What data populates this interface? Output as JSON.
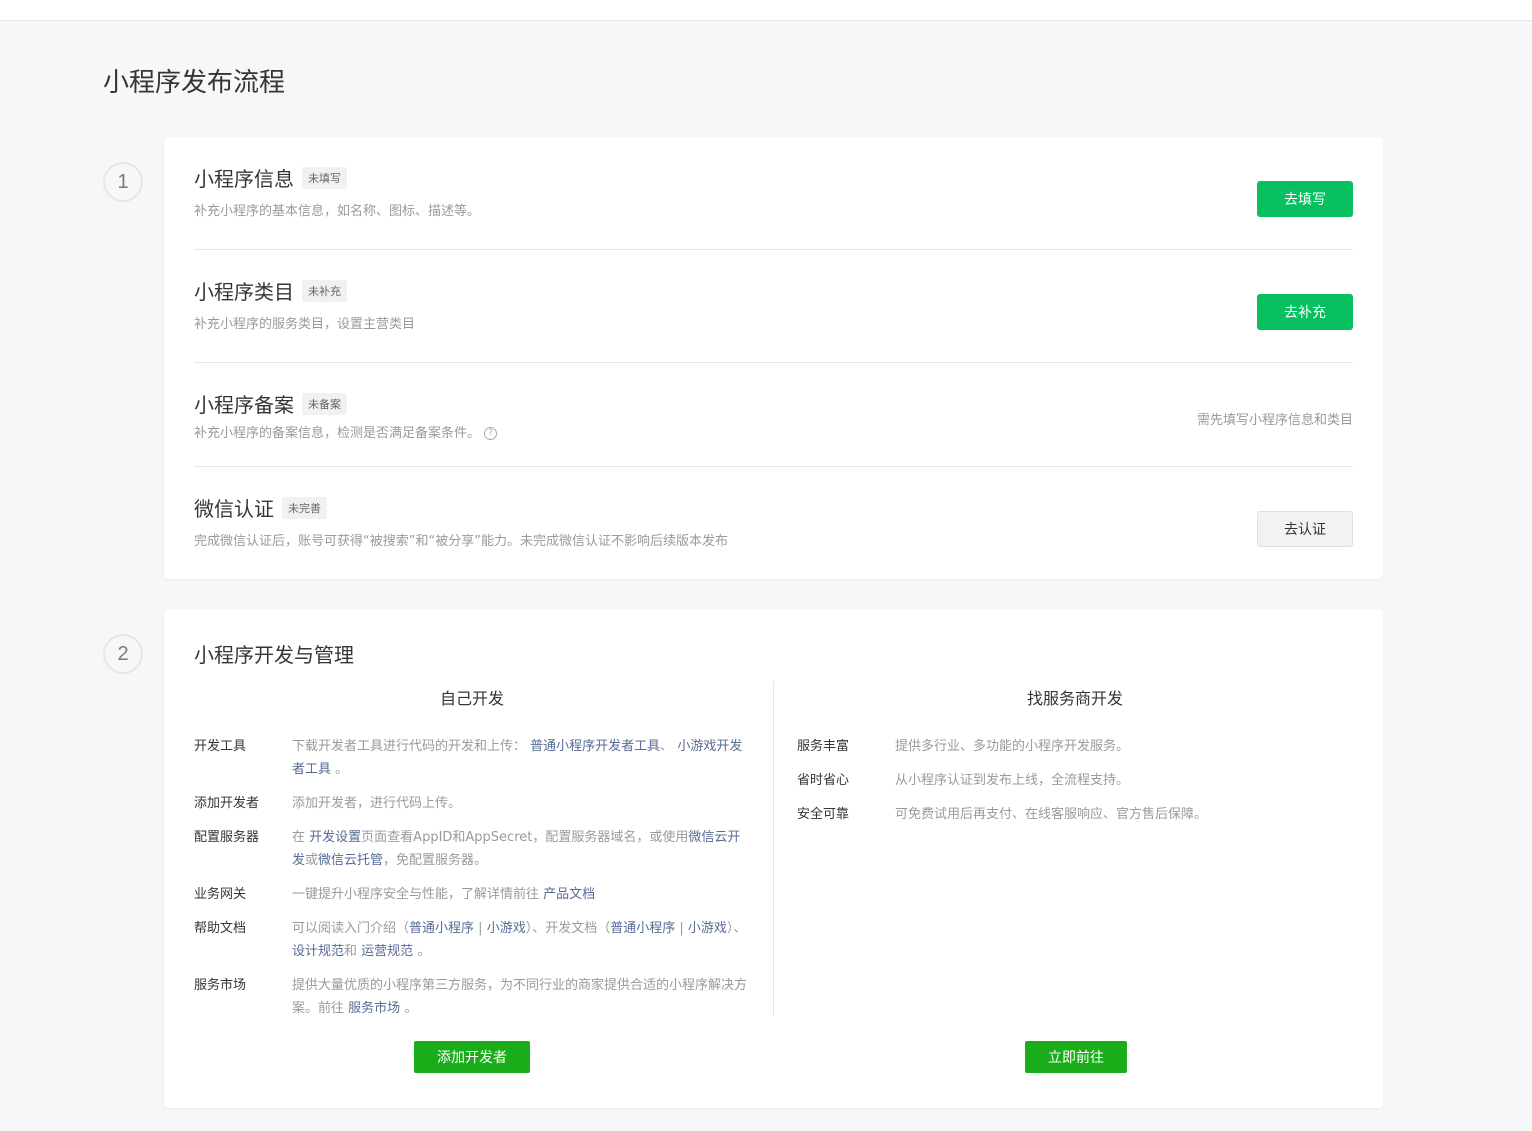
{
  "page": {
    "title": "小程序发布流程"
  },
  "steps": {
    "one": "1",
    "two": "2"
  },
  "publish_rows": [
    {
      "title": "小程序信息",
      "tag": "未填写",
      "desc": "补充小程序的基本信息，如名称、图标、描述等。",
      "action": "去填写"
    },
    {
      "title": "小程序类目",
      "tag": "未补充",
      "desc": "补充小程序的服务类目，设置主营类目",
      "action": "去补充"
    },
    {
      "title": "小程序备案",
      "tag": "未备案",
      "desc": "补充小程序的备案信息，检测是否满足备案条件。",
      "hint": "需先填写小程序信息和类目",
      "help_glyph": "?"
    },
    {
      "title": "微信认证",
      "tag": "未完善",
      "desc": "完成微信认证后，账号可获得“被搜索”和“被分享”能力。未完成微信认证不影响后续版本发布",
      "action": "去认证"
    }
  ],
  "dev": {
    "title": "小程序开发与管理",
    "self": {
      "heading": "自己开发",
      "items": {
        "tools": {
          "label": "开发工具",
          "pre": "下载开发者工具进行代码的开发和上传：",
          "link1": "普通小程序开发者工具",
          "sep": "、",
          "link2": "小游戏开发者工具",
          "end": "。"
        },
        "add_dev": {
          "label": "添加开发者",
          "desc": "添加开发者，进行代码上传。"
        },
        "server": {
          "label": "配置服务器",
          "pre": "在",
          "link1": "开发设置",
          "mid1": "页面查看AppID和AppSecret，配置服务器域名，或使用",
          "link2": "微信云开发",
          "mid2": "或",
          "link3": "微信云托管",
          "end": "，免配置服务器。"
        },
        "gateway": {
          "label": "业务网关",
          "pre": "一键提升小程序安全与性能，了解详情前往",
          "link1": "产品文档"
        },
        "help": {
          "label": "帮助文档",
          "pre": "可以阅读入门介绍（",
          "link1": "普通小程序",
          "bar": "|",
          "link2": "小游戏",
          "mid": "）、开发文档（",
          "link3": "普通小程序",
          "link4": "小游戏",
          "mid2": "）、",
          "link5": "设计规范",
          "and": "和",
          "link6": "运营规范",
          "end": "。"
        },
        "market": {
          "label": "服务市场",
          "pre": "提供大量优质的小程序第三方服务，为不同行业的商家提供合适的小程序解决方案。前往",
          "link1": "服务市场",
          "end": "。"
        }
      },
      "button": "添加开发者"
    },
    "vendor": {
      "heading": "找服务商开发",
      "items": [
        {
          "label": "服务丰富",
          "desc": "提供多行业、多功能的小程序开发服务。"
        },
        {
          "label": "省时省心",
          "desc": "从小程序认证到发布上线，全流程支持。"
        },
        {
          "label": "安全可靠",
          "desc": "可免费试用后再支付、在线客服响应、官方售后保障。"
        }
      ],
      "button": "立即前往"
    }
  },
  "colors": {
    "primary_green": "#07c160",
    "link": "#576b95",
    "solid_green": "#1aad19"
  }
}
